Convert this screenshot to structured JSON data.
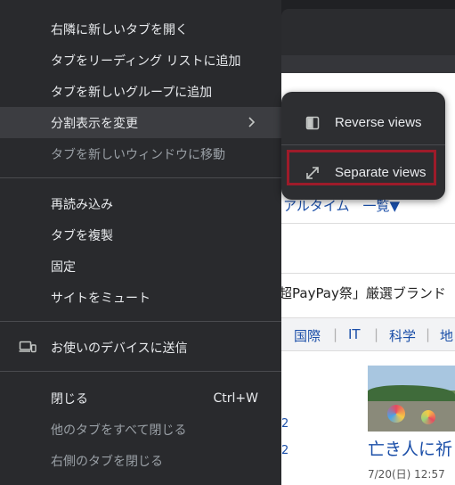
{
  "context_menu": {
    "items": [
      {
        "label": "右隣に新しいタブを開く"
      },
      {
        "label": "タブをリーディング リストに追加"
      },
      {
        "label": "タブを新しいグループに追加"
      },
      {
        "label": "分割表示を変更"
      },
      {
        "label": "タブを新しいウィンドウに移動"
      },
      {
        "label": "再読み込み"
      },
      {
        "label": "タブを複製"
      },
      {
        "label": "固定"
      },
      {
        "label": "サイトをミュート"
      },
      {
        "label": "お使いのデバイスに送信"
      },
      {
        "label": "閉じる",
        "shortcut": "Ctrl+W"
      },
      {
        "label": "他のタブをすべて閉じる"
      },
      {
        "label": "右側のタブを閉じる"
      }
    ]
  },
  "submenu": {
    "items": [
      {
        "label": "Reverse views",
        "icon": "reverse-views-icon"
      },
      {
        "label": "Separate views",
        "icon": "separate-views-icon"
      }
    ]
  },
  "background_page": {
    "realtime_text": "アルタイム　一覧▼",
    "promo_text": "超PayPay祭」厳選ブランド",
    "nav": [
      "国際",
      "IT",
      "科学",
      "地"
    ],
    "news_title": "亡き人に祈り",
    "news_time": "7/20(日) 12:57",
    "fragment_1": "2",
    "fragment_2": "2"
  }
}
